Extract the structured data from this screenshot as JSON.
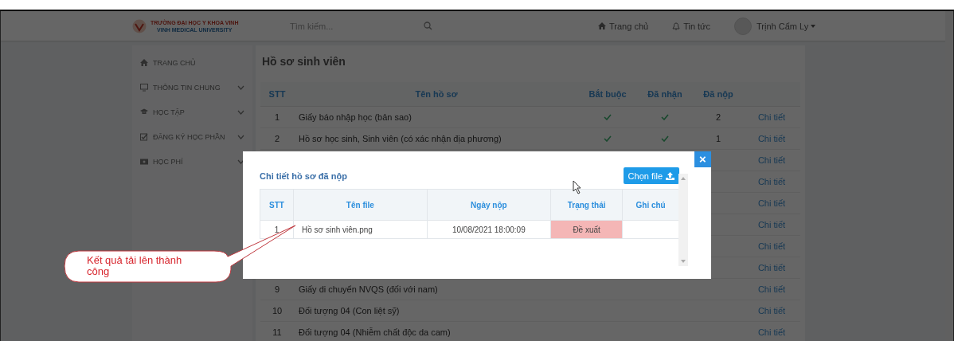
{
  "header": {
    "logo_line_1": "TRƯỜNG ĐẠI HỌC Y KHOA VINH",
    "logo_line_2": "VINH MEDICAL UNIVERSITY",
    "search_placeholder": "Tìm kiếm...",
    "links": [
      "Trang chủ",
      "Tin tức"
    ],
    "user": "Trịnh Cẩm Ly"
  },
  "sidebar": {
    "items": [
      {
        "label": "TRANG CHỦ",
        "expandable": false
      },
      {
        "label": "THÔNG TIN CHUNG",
        "expandable": true
      },
      {
        "label": "HỌC TẬP",
        "expandable": true
      },
      {
        "label": "ĐĂNG KÝ HỌC PHẦN",
        "expandable": true
      },
      {
        "label": "HỌC PHÍ",
        "expandable": true
      }
    ]
  },
  "page_title": "Hồ sơ sinh viên",
  "records_table": {
    "columns": [
      "STT",
      "Tên hồ sơ",
      "Bắt buộc",
      "Đã nhận",
      "Đã nộp"
    ],
    "rows": [
      {
        "stt": "1",
        "name": "Giấy báo nhập học (bản sao)",
        "required": true,
        "received": true,
        "submitted": "2",
        "action": "Chi tiết"
      },
      {
        "stt": "2",
        "name": "Hồ sơ học sinh, Sinh viên (có xác nhận địa phương)",
        "required": true,
        "received": true,
        "submitted": "1",
        "action": "Chi tiết"
      },
      {
        "action": "Chi tiết"
      },
      {
        "action": "Chi tiết"
      },
      {
        "action": "Chi tiết"
      },
      {
        "action": "Chi tiết"
      },
      {
        "action": "Chi tiết"
      },
      {
        "action": "Chi tiết"
      },
      {
        "stt": "9",
        "name": "Giấy di chuyển NVQS (đối với nam)",
        "required": false,
        "received": false,
        "action": "Chi tiết"
      },
      {
        "stt": "10",
        "name": "Đối tượng 04 (Con liệt sỹ)",
        "required": false,
        "received": false,
        "action": "Chi tiết"
      },
      {
        "stt": "11",
        "name": "Đối tượng 04 (Nhiễm chất độc da cam)",
        "required": false,
        "received": false,
        "action": "Chi tiết"
      }
    ]
  },
  "modal": {
    "title": "Chi tiết hồ sơ đã nộp",
    "close": "×",
    "upload_button": "Chọn file",
    "columns": [
      "STT",
      "Tên file",
      "Ngày nộp",
      "Trạng thái",
      "Ghi chú"
    ],
    "rows": [
      {
        "stt": "1",
        "file_name": "Hồ sơ sinh viên.png",
        "date": "10/08/2021 18:00:09",
        "status": "Đề xuất",
        "color": "#f4b6b6"
      }
    ]
  },
  "callout": {
    "text": "Kết quả tải lên thành công"
  }
}
